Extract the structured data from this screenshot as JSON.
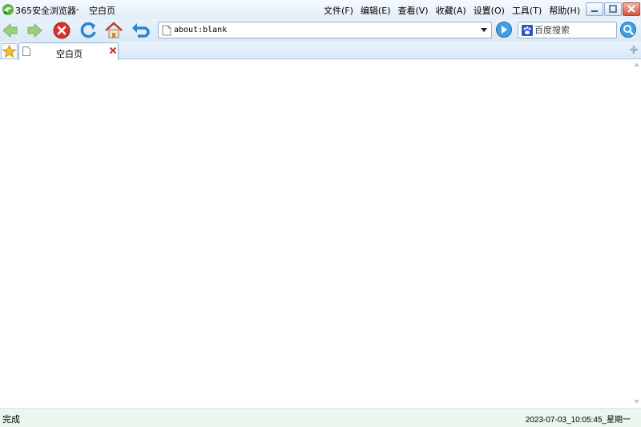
{
  "window": {
    "app_name": "365安全浏览器",
    "separator": "-",
    "page_title": "空白页"
  },
  "menu": {
    "items": [
      {
        "label": "文件(F)"
      },
      {
        "label": "编辑(E)"
      },
      {
        "label": "查看(V)"
      },
      {
        "label": "收藏(A)"
      },
      {
        "label": "设置(O)"
      },
      {
        "label": "工具(T)"
      },
      {
        "label": "帮助(H)"
      }
    ]
  },
  "toolbar": {
    "icons": [
      "arrow-left-icon",
      "arrow-right-icon",
      "stop-icon",
      "refresh-icon",
      "home-icon",
      "undo-close-icon"
    ]
  },
  "address": {
    "value": "about:blank"
  },
  "search": {
    "placeholder": "百度搜索"
  },
  "tabs": [
    {
      "title": "空白页",
      "active": true
    }
  ],
  "status": {
    "text": "完成",
    "clock": "2023-07-03_10:05:45_星期一"
  },
  "colors": {
    "chrome_bg": "#e3eef8",
    "status_bg": "#e9f7ee",
    "close_red": "#d0302a",
    "nav_green": "#8fc36a",
    "accent_blue": "#2a7fc9"
  }
}
